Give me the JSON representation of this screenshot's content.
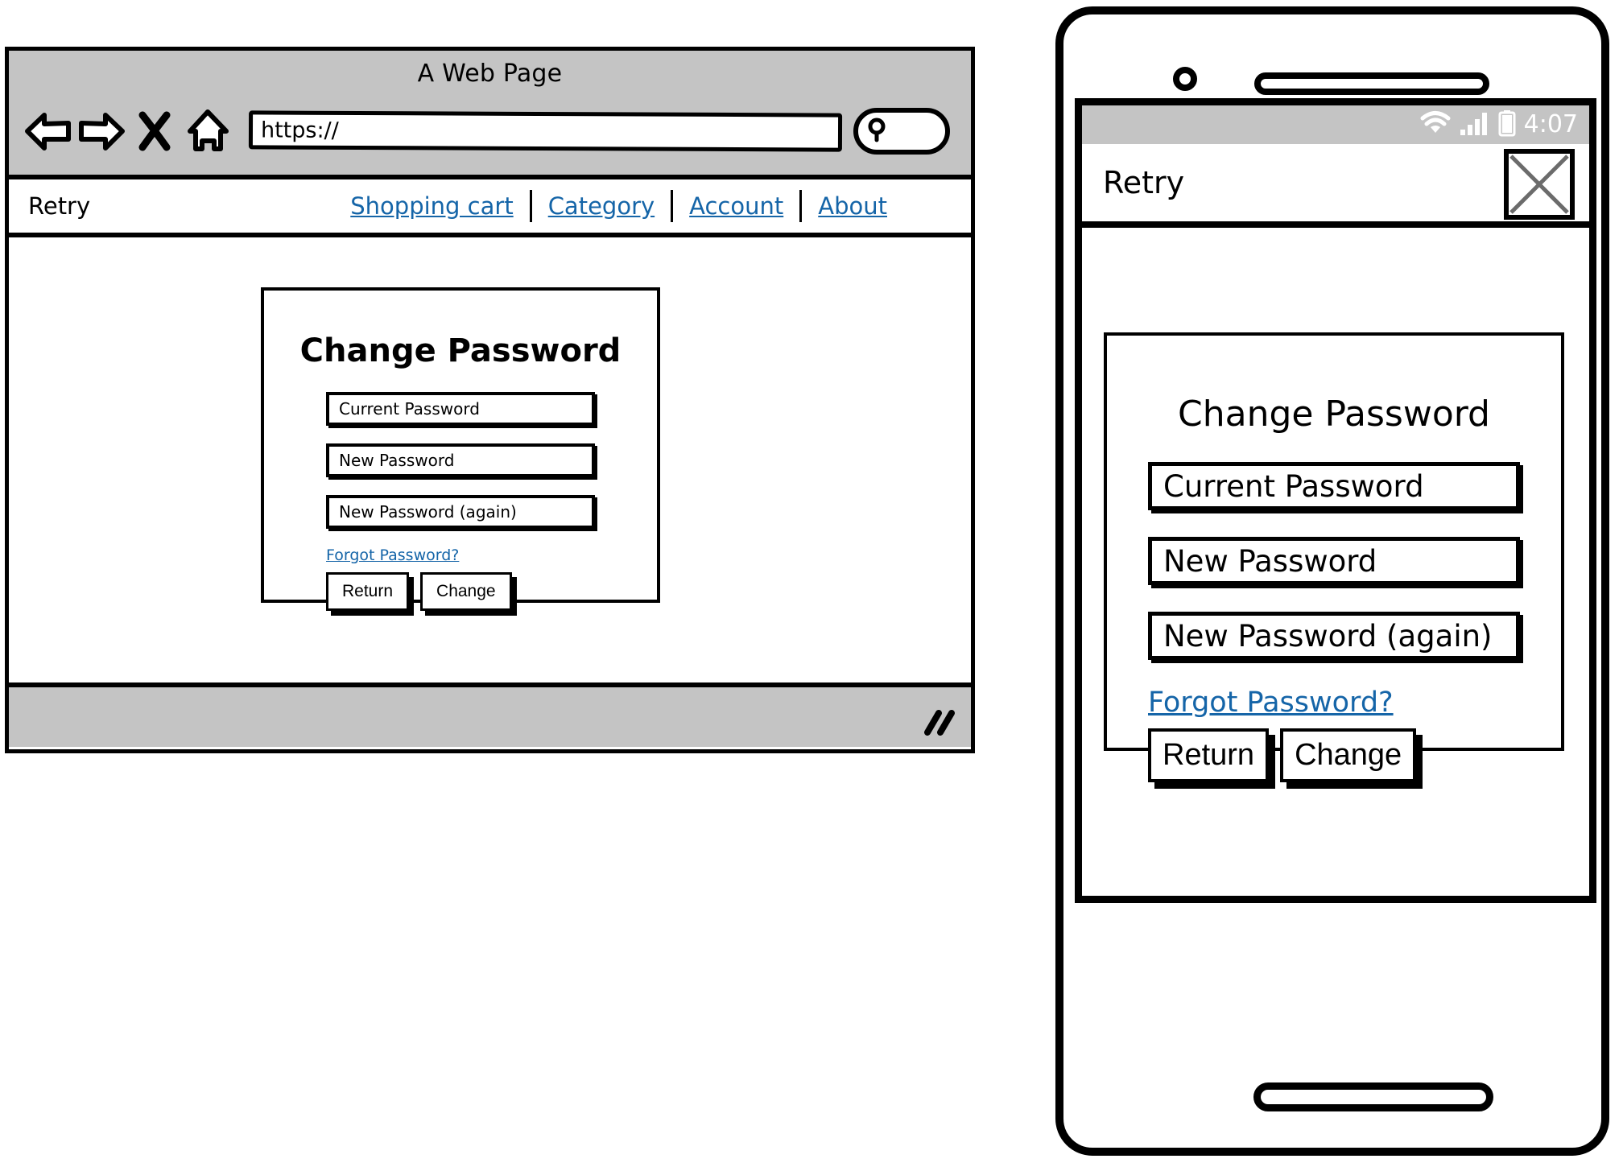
{
  "browser": {
    "window_title": "A Web Page",
    "toolbar": {
      "back_icon": "back-arrow-icon",
      "forward_icon": "forward-arrow-icon",
      "stop_icon": "stop-x-icon",
      "home_icon": "home-icon",
      "search_icon": "magnifier-icon"
    },
    "url_value": "https://",
    "url_placeholder": "https://",
    "search_value": "",
    "search_placeholder": "",
    "site": {
      "brand": "Retry",
      "nav_links": [
        "Shopping cart",
        "Category",
        "Account",
        "About"
      ]
    },
    "footer": {
      "resize_grip_icon": "resize-grip-icon"
    }
  },
  "form": {
    "title": "Change Password",
    "fields": [
      {
        "label": "Current Password",
        "value": ""
      },
      {
        "label": "New Password",
        "value": ""
      },
      {
        "label": "New Password (again)",
        "value": ""
      }
    ],
    "forgot_link": "Forgot Password?",
    "buttons": {
      "return": "Return",
      "change": "Change"
    }
  },
  "phone": {
    "hardware": {
      "camera_icon": "camera-icon",
      "speaker_icon": "speaker-grille-icon",
      "home_button_icon": "home-button-icon"
    },
    "statusbar": {
      "wifi_icon": "wifi-icon",
      "signal_icon": "signal-bars-icon",
      "battery_icon": "battery-icon",
      "time": "4:07"
    },
    "appbar": {
      "brand": "Retry",
      "close_icon": "close-x-icon"
    }
  },
  "colors": {
    "chrome_gray": "#c4c4c4",
    "link_blue": "#1565a8",
    "ink_black": "#000000",
    "paper_white": "#ffffff",
    "close_x_gray": "#6b6b6b"
  }
}
